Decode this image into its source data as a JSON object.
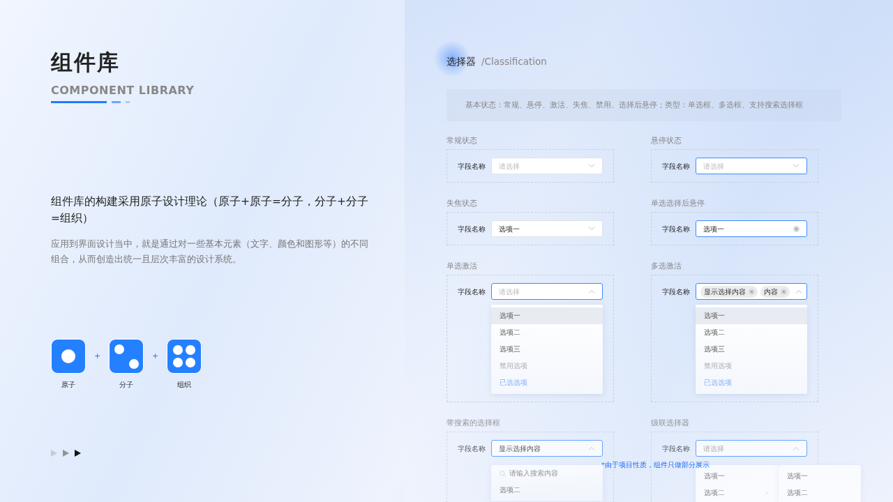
{
  "intro": {
    "title": "组件库",
    "subtitle": "COMPONENT LIBRARY",
    "heading": "组件库的构建采用原子设计理论（原子+原子=分子，分子+分子=组织）",
    "description": "应用到界面设计当中，就是通过对一些基本元素（文字、颜色和图形等）的不同组合，从而创造出统一且层次丰富的设计系统。"
  },
  "formula": [
    {
      "kind": "atom",
      "text": "原子"
    },
    {
      "kind": "plus",
      "text": "+"
    },
    {
      "kind": "molecule",
      "text": "分子"
    },
    {
      "kind": "plus",
      "text": "+"
    },
    {
      "kind": "organism",
      "text": "组织"
    }
  ],
  "pager": [
    {
      "selected": false
    },
    {
      "selected": false
    },
    {
      "selected": true
    }
  ],
  "header": {
    "title": "选择器",
    "subtitle": "/Classification"
  },
  "notice": "基本状态：常规、悬停、激活、失焦、禁用、选择后悬停；类型：单选框、多选框、支持搜索选择框",
  "sections": [
    {
      "title": "常规状态",
      "faded": false,
      "label": "字段名称",
      "select": {
        "placeholder": "请选择",
        "focused": false,
        "expanded": false,
        "clearable": false
      }
    },
    {
      "title": "悬停状态",
      "faded": false,
      "label": "字段名称",
      "select": {
        "placeholder": "请选择",
        "focused": true,
        "expanded": false,
        "clearable": false
      }
    },
    {
      "title": "失焦状态",
      "faded": false,
      "label": "字段名称",
      "select": {
        "value": "选项一",
        "focused": false,
        "expanded": false,
        "clearable": false
      }
    },
    {
      "title": "单选选择后悬停",
      "faded": false,
      "label": "字段名称",
      "select": {
        "value": "选项一",
        "focused": true,
        "clearable": true
      }
    },
    {
      "title": "单选激活",
      "faded": false,
      "label": "字段名称",
      "select": {
        "placeholder": "请选择",
        "focused": true,
        "expanded": true,
        "clearable": false
      },
      "dropdown": {
        "kind": "list",
        "options": [
          {
            "text": "选项一",
            "hovered": true,
            "disabled": false,
            "selected": false
          },
          {
            "text": "选项二",
            "hovered": false,
            "disabled": false,
            "selected": false
          },
          {
            "text": "选项三",
            "hovered": false,
            "disabled": false,
            "selected": false
          },
          {
            "text": "禁用选项",
            "hovered": false,
            "disabled": true,
            "selected": false
          },
          {
            "text": "已选选项",
            "hovered": false,
            "disabled": false,
            "selected": true
          }
        ]
      }
    },
    {
      "title": "多选激活",
      "faded": false,
      "label": "字段名称",
      "select": {
        "tags": [
          "显示选择内容",
          "内容"
        ],
        "focused": true,
        "expanded": true,
        "clearable": false
      },
      "dropdown": {
        "kind": "list",
        "options": [
          {
            "text": "选项一",
            "hovered": true,
            "disabled": false,
            "selected": false
          },
          {
            "text": "选项二",
            "hovered": false,
            "disabled": false,
            "selected": false
          },
          {
            "text": "选项三",
            "hovered": false,
            "disabled": false,
            "selected": false
          },
          {
            "text": "禁用选项",
            "hovered": false,
            "disabled": true,
            "selected": false
          },
          {
            "text": "已选选项",
            "hovered": false,
            "disabled": false,
            "selected": true
          }
        ]
      }
    },
    {
      "title": "带搜索的选择框",
      "faded": true,
      "label": "字段名称",
      "select": {
        "value": "显示选择内容",
        "focused": true,
        "expanded": true,
        "clearable": false
      },
      "dropdown": {
        "kind": "search",
        "search_placeholder": "请输入搜索内容",
        "options": [
          {
            "text": "选项二",
            "hovered": false,
            "disabled": false,
            "selected": false
          }
        ]
      }
    },
    {
      "title": "级联选择器",
      "faded": true,
      "label": "字段名称",
      "select": {
        "placeholder": "请选择",
        "focused": true,
        "expanded": true,
        "clearable": false
      },
      "dropdown": {
        "kind": "cascader",
        "columns": [
          [
            {
              "text": "选项一",
              "has_children": false
            },
            {
              "text": "选项二",
              "has_children": true
            }
          ],
          [
            {
              "text": "选项一",
              "has_children": false
            },
            {
              "text": "选项二",
              "has_children": false
            }
          ]
        ]
      }
    }
  ],
  "footnote": "*由于项目性质，组件只做部分展示"
}
